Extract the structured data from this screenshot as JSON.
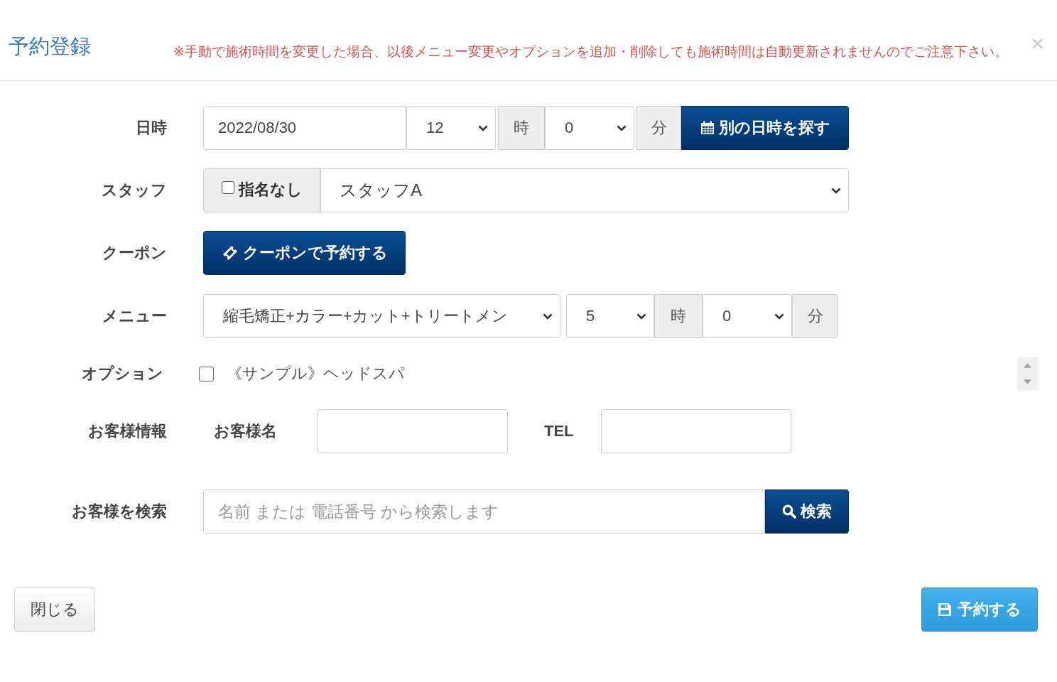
{
  "modal": {
    "title": "予約登録",
    "notice": "※手動で施術時間を変更した場合、以後メニュー変更やオプションを追加・削除しても施術時間は自動更新されませんのでご注意下さい。",
    "close": "×"
  },
  "form": {
    "datetime": {
      "label": "日時",
      "date": "2022/08/30",
      "hour": "12",
      "hour_unit": "時",
      "minute": "0",
      "minute_unit": "分",
      "button": "別の日時を探す"
    },
    "staff": {
      "label": "スタッフ",
      "no_preference": {
        "label": "指名なし",
        "checked": false
      },
      "value": "スタッフA"
    },
    "coupon": {
      "label": "クーポン",
      "button": "クーポンで予約する"
    },
    "menu": {
      "label": "メニュー",
      "value": "縮毛矯正+カラー+カット+トリートメン",
      "hours": "5",
      "hour_unit": "時",
      "minutes": "0",
      "minute_unit": "分"
    },
    "options": {
      "label": "オプション",
      "items": [
        {
          "label": "《サンプル》ヘッドスパ",
          "checked": false
        }
      ]
    },
    "customer": {
      "label": "お客様情報",
      "name_label": "お客様名",
      "tel_label": "TEL"
    },
    "search": {
      "label": "お客様を検索",
      "placeholder": "名前 または 電話番号 から検索します",
      "button": "検索"
    }
  },
  "footer": {
    "close_button": "閉じる",
    "submit_button": "予約する"
  }
}
